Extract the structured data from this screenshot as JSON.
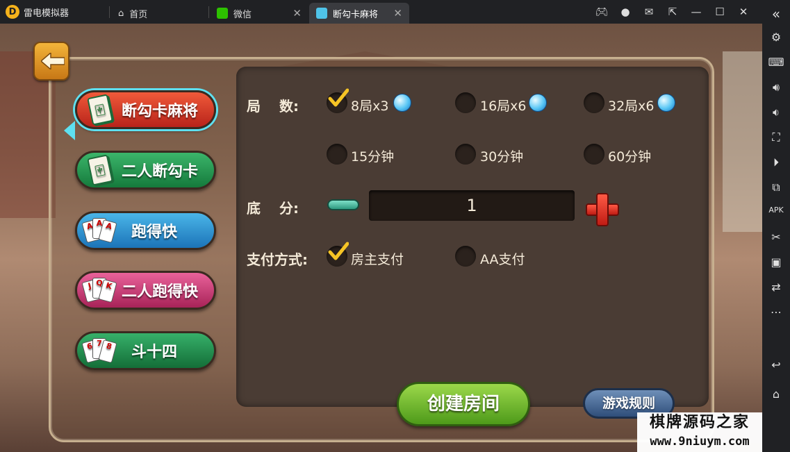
{
  "emulator": {
    "app_name": "雷电模拟器",
    "logo_text": "D",
    "tabs": [
      {
        "label": "首页",
        "icon": "home-icon"
      },
      {
        "label": "微信",
        "icon": "wechat-icon"
      },
      {
        "label": "断勾卡麻将",
        "icon": "game-app-icon"
      }
    ],
    "close_glyph": "✕",
    "window_controls": {
      "minimize": "—",
      "maximize": "☐",
      "close": "✕",
      "collapse": "«"
    }
  },
  "game": {
    "modes": [
      {
        "label": "断勾卡麻将",
        "icon": "mahjong-tile-icon",
        "selected": true
      },
      {
        "label": "二人断勾卡",
        "icon": "mahjong-tile-icon",
        "selected": false
      },
      {
        "label": "跑得快",
        "icon": "playing-cards-icon",
        "selected": false
      },
      {
        "label": "二人跑得快",
        "icon": "playing-cards-icon",
        "selected": false
      },
      {
        "label": "斗十四",
        "icon": "playing-cards-icon",
        "selected": false
      }
    ],
    "rounds_label": "局　 数:",
    "round_options": [
      {
        "label": "8局x3",
        "checked": true
      },
      {
        "label": "16局x6",
        "checked": false
      },
      {
        "label": "32局x6",
        "checked": false
      }
    ],
    "time_options": [
      {
        "label": "15分钟",
        "checked": false
      },
      {
        "label": "30分钟",
        "checked": false
      },
      {
        "label": "60分钟",
        "checked": false
      }
    ],
    "base_score_label": "底　 分:",
    "base_score_value": "1",
    "payment_label": "支付方式:",
    "payment_options": [
      {
        "label": "房主支付",
        "checked": true
      },
      {
        "label": "AA支付",
        "checked": false
      }
    ],
    "create_button": "创建房间",
    "rules_button": "游戏规则"
  },
  "watermark": {
    "line1": "棋牌源码之家",
    "line2": "www.9niuym.com"
  },
  "colors": {
    "accent_selected": "#5ee0f0",
    "panel": "#4a3c34",
    "create_green": "#6fb52e"
  }
}
